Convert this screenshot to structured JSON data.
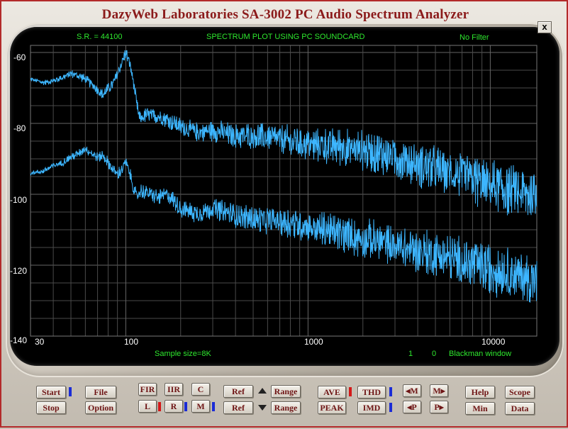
{
  "window": {
    "title": "DazyWeb Laboratories SA-3002 PC Audio Spectrum Analyzer",
    "close_label": "x"
  },
  "plot": {
    "sample_rate": "S.R. = 44100",
    "heading": "SPECTRUM PLOT USING PC SOUNDCARD",
    "filter": "No Filter",
    "sample_size": "Sample size=8K",
    "counter_a": "1",
    "counter_b": "0",
    "window_type": "Blackman window",
    "y_ticks": [
      "-60",
      "-80",
      "-100",
      "-120",
      "-140"
    ],
    "x_ticks": [
      "30",
      "100",
      "1000",
      "10000"
    ]
  },
  "chart_data": {
    "type": "line",
    "x_scale": "log",
    "xlim": [
      30,
      18000
    ],
    "ylim": [
      -140,
      -58
    ],
    "grid": true,
    "trace_color": "#3db6ff",
    "grid_color": "#4a4a4a",
    "series": [
      {
        "points": [
          [
            30,
            -67.5
          ],
          [
            35,
            -68.5
          ],
          [
            40,
            -68
          ],
          [
            45,
            -67
          ],
          [
            50,
            -66
          ],
          [
            55,
            -66.5
          ],
          [
            60,
            -67.5
          ],
          [
            65,
            -69
          ],
          [
            70,
            -70.5
          ],
          [
            75,
            -72
          ],
          [
            80,
            -70
          ],
          [
            85,
            -69
          ],
          [
            90,
            -66
          ],
          [
            95,
            -63
          ],
          [
            100,
            -60
          ],
          [
            105,
            -63
          ],
          [
            110,
            -68
          ],
          [
            115,
            -75
          ],
          [
            120,
            -79
          ],
          [
            130,
            -77.5
          ],
          [
            150,
            -78
          ],
          [
            170,
            -79
          ],
          [
            200,
            -81
          ],
          [
            250,
            -82.5
          ],
          [
            300,
            -82
          ],
          [
            400,
            -83.5
          ],
          [
            500,
            -83.5
          ],
          [
            700,
            -84.5
          ],
          [
            1000,
            -86
          ],
          [
            1500,
            -86.5
          ],
          [
            2000,
            -87.5
          ],
          [
            3000,
            -89.5
          ],
          [
            5000,
            -93
          ],
          [
            7000,
            -95
          ],
          [
            10000,
            -97.5
          ],
          [
            14000,
            -99.5
          ],
          [
            18000,
            -100.5
          ]
        ],
        "spread": [
          [
            30,
            0.5
          ],
          [
            100,
            1.5
          ],
          [
            300,
            2.5
          ],
          [
            1000,
            4
          ],
          [
            3000,
            5
          ],
          [
            10000,
            6
          ],
          [
            18000,
            6
          ]
        ]
      },
      {
        "points": [
          [
            30,
            -94
          ],
          [
            35,
            -93.5
          ],
          [
            40,
            -92
          ],
          [
            45,
            -91
          ],
          [
            50,
            -89.5
          ],
          [
            55,
            -88.5
          ],
          [
            60,
            -87
          ],
          [
            65,
            -88.5
          ],
          [
            70,
            -89.5
          ],
          [
            75,
            -89
          ],
          [
            80,
            -91
          ],
          [
            85,
            -93
          ],
          [
            90,
            -94.5
          ],
          [
            95,
            -93
          ],
          [
            100,
            -91
          ],
          [
            105,
            -94
          ],
          [
            110,
            -98
          ],
          [
            115,
            -101
          ],
          [
            120,
            -99
          ],
          [
            130,
            -99.5
          ],
          [
            150,
            -101
          ],
          [
            170,
            -100
          ],
          [
            200,
            -104
          ],
          [
            250,
            -105.5
          ],
          [
            300,
            -104
          ],
          [
            400,
            -106
          ],
          [
            500,
            -107
          ],
          [
            700,
            -107.5
          ],
          [
            1000,
            -109
          ],
          [
            1500,
            -111
          ],
          [
            2000,
            -112.5
          ],
          [
            3000,
            -114.5
          ],
          [
            5000,
            -117
          ],
          [
            7000,
            -119
          ],
          [
            10000,
            -121
          ],
          [
            14000,
            -123
          ],
          [
            18000,
            -124
          ]
        ],
        "spread": [
          [
            30,
            0.5
          ],
          [
            100,
            1.5
          ],
          [
            300,
            2.5
          ],
          [
            1000,
            4
          ],
          [
            3000,
            5
          ],
          [
            10000,
            6
          ],
          [
            18000,
            6
          ]
        ]
      }
    ]
  },
  "controls": {
    "start": "Start",
    "stop": "Stop",
    "file": "File",
    "option": "Option",
    "fir": "FIR",
    "iir": "IIR",
    "c": "C",
    "l": "L",
    "r": "R",
    "m": "M",
    "ref_up": "Ref",
    "ref_down": "Ref",
    "range_up": "Range",
    "range_down": "Range",
    "ave": "AVE",
    "peak": "PEAK",
    "thd": "THD",
    "imd": "IMD",
    "m_left": "M",
    "m_right": "M",
    "p_left": "P",
    "p_right": "P",
    "help": "Help",
    "min": "Min",
    "scope": "Scope",
    "data": "Data"
  }
}
